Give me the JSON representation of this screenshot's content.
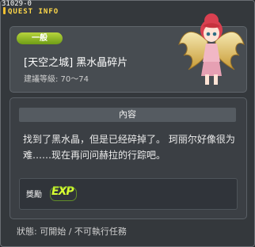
{
  "window": {
    "quest_id": "31029-0",
    "title": "QUEST INFO"
  },
  "header": {
    "badge": "一般",
    "quest_name": "[天空之城] 黑水晶碎片",
    "recommended_level": "建議等級: 70～74"
  },
  "content": {
    "title": "內容",
    "description": "找到了黑水晶，但是已经碎掉了。 珂丽尔好像很为难……现在再问问赫拉的行踪吧。"
  },
  "reward": {
    "label": "獎勵",
    "icon_text": "EXP"
  },
  "status": {
    "text": "狀態: 可開始 / 不可執行任務"
  },
  "colors": {
    "accent": "#ffd84a",
    "badge": "#8fbd25",
    "exp": "#d7ff31",
    "background": "#34383c"
  }
}
